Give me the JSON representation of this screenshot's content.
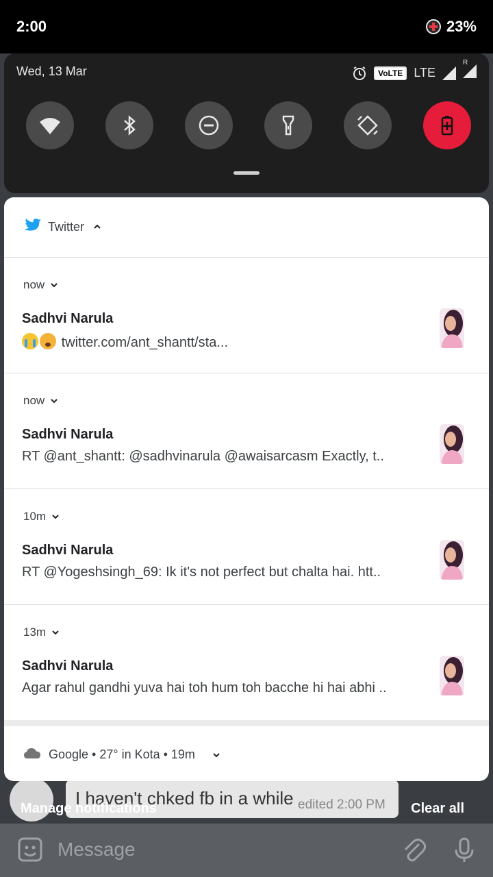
{
  "status_bar": {
    "time": "2:00",
    "battery": "23%"
  },
  "quick_settings": {
    "date": "Wed, 13 Mar",
    "volte": "VoLTE",
    "network": "LTE",
    "roaming": "R",
    "tiles": [
      "wifi",
      "bluetooth",
      "do-not-disturb",
      "flashlight",
      "auto-rotate",
      "battery-saver"
    ]
  },
  "notifications": {
    "app_name": "Twitter",
    "items": [
      {
        "time": "now",
        "title": "Sadhvi Narula",
        "body": "twitter.com/ant_shantt/sta..."
      },
      {
        "time": "now",
        "title": "Sadhvi Narula",
        "body": "RT @ant_shantt: @sadhvinarula @awaisarcasm Exactly, t.."
      },
      {
        "time": "10m",
        "title": "Sadhvi Narula",
        "body": "RT @Yogeshsingh_69: Ik it's not perfect but chalta hai. htt.."
      },
      {
        "time": "13m",
        "title": "Sadhvi Narula",
        "body": "Agar rahul gandhi yuva hai toh hum toh bacche hi hai abhi .."
      }
    ],
    "google_row": "Google • 27° in Kota • 19m"
  },
  "footer": {
    "manage": "Manage notifications",
    "clear": "Clear all"
  },
  "background_app": {
    "message_text": "I haven't chked fb in a while",
    "edited": "edited 2:00 PM",
    "composer_placeholder": "Message"
  },
  "colors": {
    "accent_red": "#e51c3a",
    "twitter_blue": "#1da1f2"
  }
}
